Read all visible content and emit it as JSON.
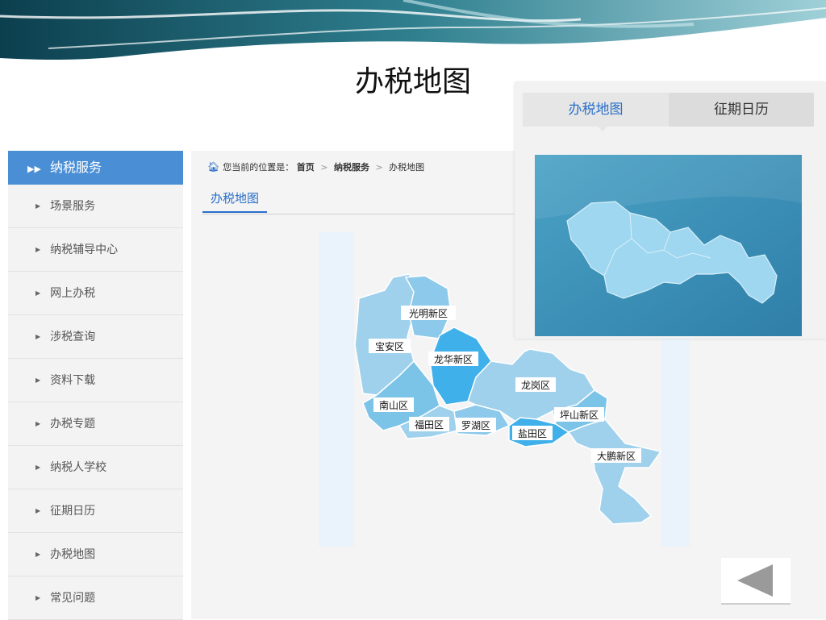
{
  "slide": {
    "title": "办税地图"
  },
  "sidebar": {
    "header": "纳税服务",
    "items": [
      {
        "label": "场景服务"
      },
      {
        "label": "纳税辅导中心"
      },
      {
        "label": "网上办税"
      },
      {
        "label": "涉税查询"
      },
      {
        "label": "资料下载"
      },
      {
        "label": "办税专题"
      },
      {
        "label": "纳税人学校"
      },
      {
        "label": "征期日历"
      },
      {
        "label": "办税地图"
      },
      {
        "label": "常见问题"
      }
    ]
  },
  "breadcrumb": {
    "prefix": "您当前的位置是：",
    "home": "首页",
    "level1": "纳税服务",
    "level2": "办税地图",
    "separator": ">"
  },
  "page_tab": {
    "label": "办税地图"
  },
  "map": {
    "districts": [
      {
        "name": "光明新区"
      },
      {
        "name": "宝安区"
      },
      {
        "name": "龙华新区"
      },
      {
        "name": "龙岗区"
      },
      {
        "name": "南山区"
      },
      {
        "name": "福田区"
      },
      {
        "name": "罗湖区"
      },
      {
        "name": "盐田区"
      },
      {
        "name": "坪山新区"
      },
      {
        "name": "大鹏新区"
      }
    ]
  },
  "overlay": {
    "tabs": [
      {
        "label": "办税地图",
        "active": true
      },
      {
        "label": "征期日历",
        "active": false
      }
    ]
  },
  "colors": {
    "accent": "#4a8fd6",
    "link": "#2a6fc9",
    "map_light": "#9fd1ec",
    "map_mid": "#7cc3e8",
    "map_dark": "#3fb0ea"
  }
}
